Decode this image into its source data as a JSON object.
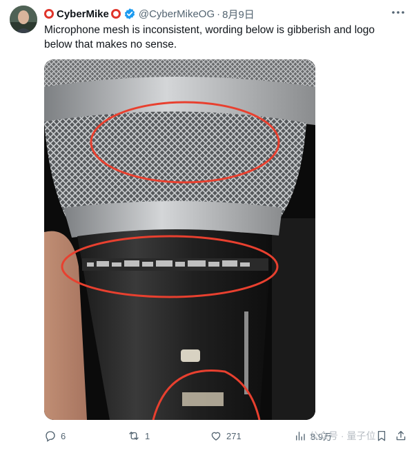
{
  "tweet": {
    "display_name": "CyberMike",
    "handle": "@CyberMikeOG",
    "separator": "·",
    "date": "8月9日",
    "text": "Microphone mesh is inconsistent, wording below is gibberish and logo below that makes no sense."
  },
  "icons": {
    "avatar": "avatar",
    "name_emoji": "red-circle-icon",
    "verified": "verified-badge-icon",
    "more": "more-icon",
    "reply": "reply-icon",
    "retweet": "retweet-icon",
    "like": "like-icon",
    "views": "views-icon",
    "bookmark": "bookmark-icon",
    "share": "share-icon"
  },
  "actions": {
    "reply_count": "6",
    "retweet_count": "1",
    "like_count": "271",
    "views_count": "8.9万"
  },
  "watermark": {
    "text": "公众号 · 量子位"
  },
  "colors": {
    "accent": "#1d9bf0",
    "annotation": "#e8402f",
    "text_secondary": "#536471"
  }
}
